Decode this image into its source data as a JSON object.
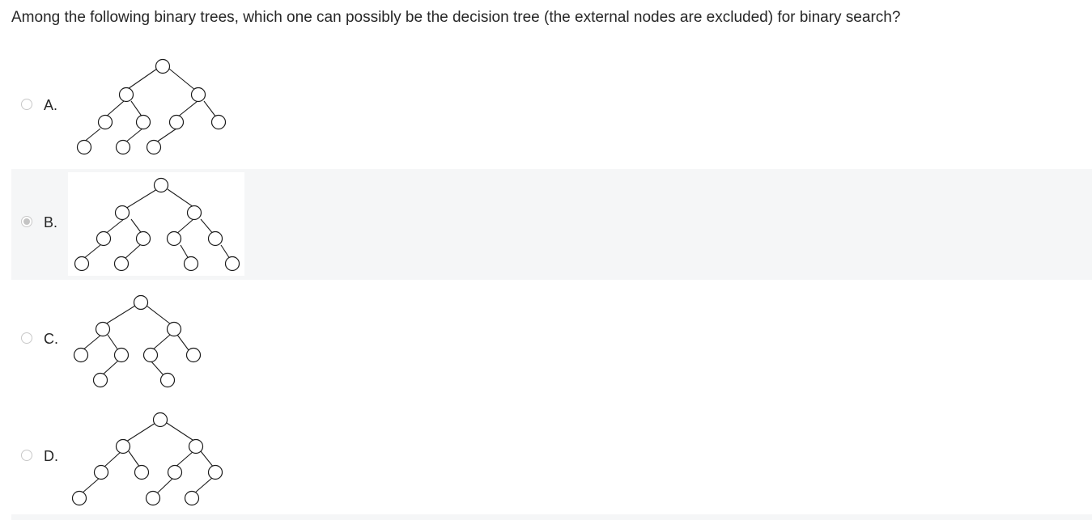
{
  "question": {
    "text": "Among the following binary trees, which one can possibly be the decision tree (the external nodes are excluded) for binary search?"
  },
  "options": [
    {
      "letter": "A.",
      "selected": false
    },
    {
      "letter": "B.",
      "selected": true
    },
    {
      "letter": "C.",
      "selected": false
    },
    {
      "letter": "D.",
      "selected": false
    }
  ],
  "colors": {
    "selected_row_bg": "#f5f6f7",
    "radio_border": "#c8c8c8",
    "text": "#262626"
  }
}
